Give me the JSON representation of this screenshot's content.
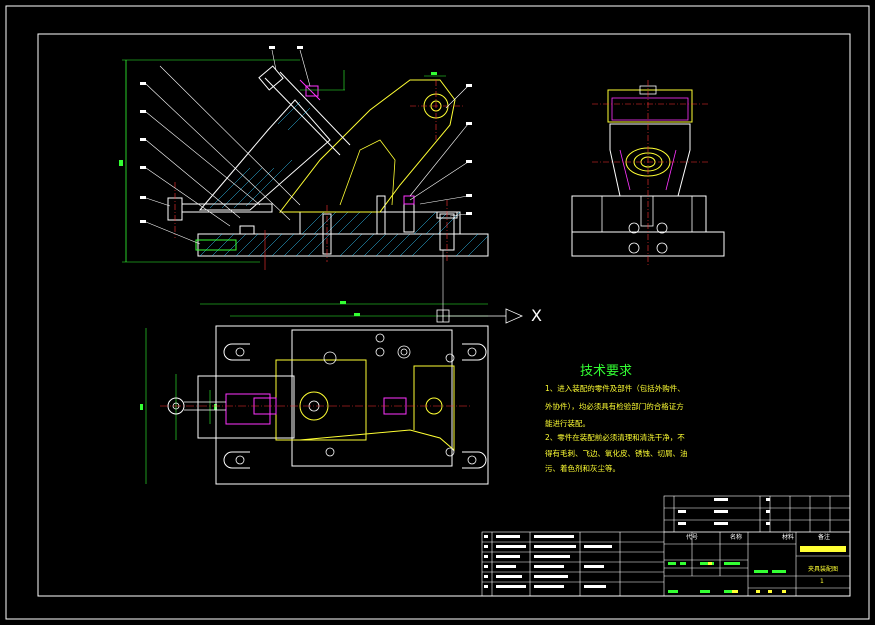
{
  "drawing": {
    "colors": {
      "background": "#000000",
      "frame": "#ffffff",
      "outline": "#ffffff",
      "centerline": "#ff3333",
      "hatch": "#33ccff",
      "dimension": "#33ff33",
      "highlight": "#ff33ff",
      "part": "#ffff33"
    },
    "axis_label": "X",
    "technical_requirements": {
      "title": "技术要求",
      "lines": [
        "1、进入装配的零件及部件（包括外购件、",
        "外协件），均必须具有检验部门的合格证方",
        "能进行装配。",
        "2、零件在装配前必须清理和清洗干净，不",
        "得有毛刺、飞边、氧化皮、锈蚀、切屑、油",
        "污、着色剂和灰尘等。"
      ]
    },
    "title_block": {
      "header_cells": [
        "代号",
        "名称",
        "材料",
        "备注"
      ],
      "drawing_name": "夹具装配图",
      "sheet": "1"
    }
  }
}
